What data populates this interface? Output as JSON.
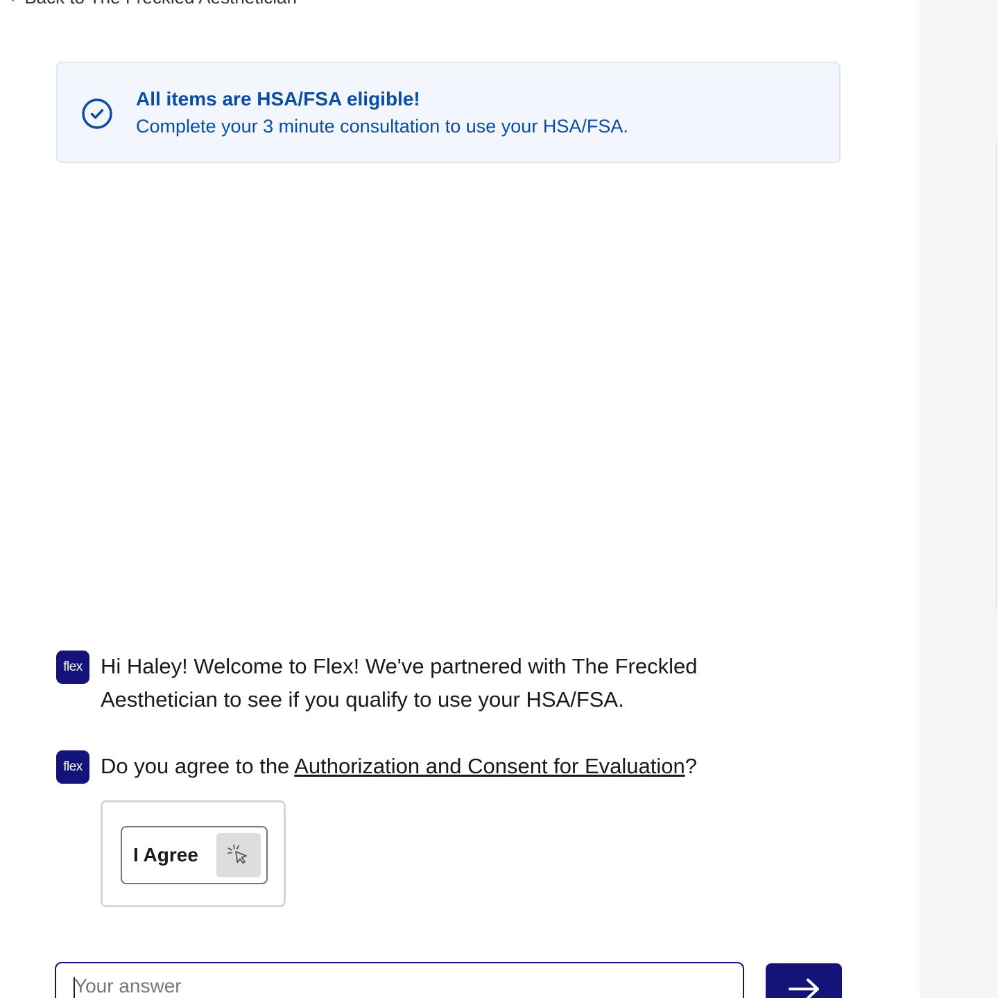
{
  "nav": {
    "back_label": "Back to The Freckled Aesthetician"
  },
  "banner": {
    "title": "All items are HSA/FSA eligible!",
    "subtitle": "Complete your 3 minute consultation to use your HSA/FSA.",
    "icon": "check-circle-icon"
  },
  "chat": {
    "avatar_label": "flex",
    "messages": [
      {
        "text": "Hi Haley! Welcome to Flex! We've partnered with The Freckled Aesthetician to see if you qualify to use your HSA/FSA."
      },
      {
        "text_before": "Do you agree to the ",
        "link_text": "Authorization and Consent for Evaluation",
        "text_after": "?"
      }
    ],
    "options": [
      {
        "label": "I Agree",
        "icon": "pointer-click-icon"
      }
    ]
  },
  "composer": {
    "placeholder": "Your answer",
    "value": "",
    "send_icon": "arrow-right-icon"
  },
  "colors": {
    "brand_navy": "#13137a",
    "banner_text": "#0b4da2",
    "banner_bg": "#f3f7fd",
    "banner_border": "#dbe7f5",
    "side_panel": "#f5f5f5"
  }
}
